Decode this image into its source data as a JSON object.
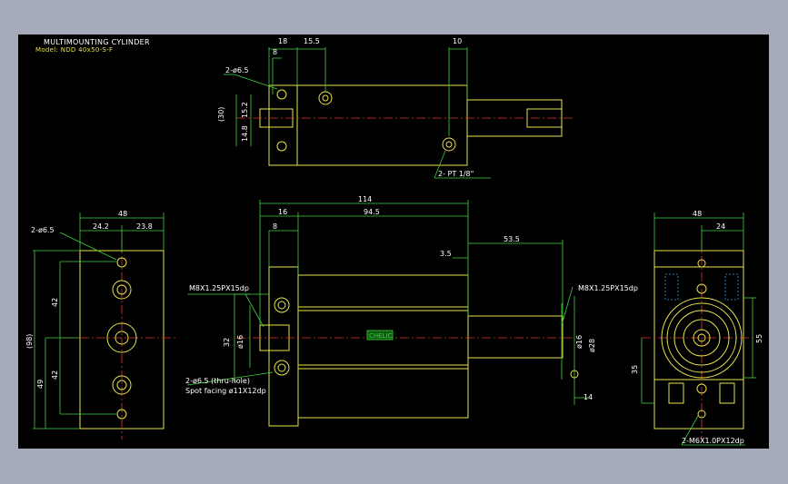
{
  "drawing": {
    "title": "MULTIMOUNTING CYLINDER",
    "model": "Model: NDD 40x50-S-F"
  },
  "top_view": {
    "dim_18": "18",
    "dim_15_5": "15.5",
    "dim_10": "10",
    "dim_8": "8",
    "hole_label": "2-ø6.5",
    "dim_30": "(30)",
    "dim_15_2": "15.2",
    "dim_14_8": "14.8",
    "port_label": "2- PT 1/8\""
  },
  "front_view": {
    "dim_114": "114",
    "dim_16": "16",
    "dim_94_5": "94.5",
    "dim_8": "8",
    "dim_53_5": "53.5",
    "dim_3_5": "3.5",
    "thread_left": "M8X1.25PX15dp",
    "thread_right": "M8X1.25PX15dp",
    "dim_32": "32",
    "dim_phi16_left": "ø16",
    "dim_phi16_right": "ø16",
    "dim_phi28": "ø28",
    "hole_label_1": "2-ø6.5 (thru-hole)",
    "hole_label_2": "Spot facing ø11X12dp",
    "dim_14": "14",
    "logo": "CHELIC"
  },
  "left_view": {
    "dim_48": "48",
    "dim_24_2": "24.2",
    "dim_23_8": "23.8",
    "hole_label": "2-ø6.5",
    "dim_42a": "42",
    "dim_42b": "42",
    "dim_98": "(98)",
    "dim_49": "49"
  },
  "right_view": {
    "dim_48": "48",
    "dim_24": "24",
    "dim_55": "55",
    "dim_35": "35",
    "thread_label": "2-M6X1.0PX12dp"
  },
  "colors": {
    "background": "#000000",
    "outline": "#e6e34a",
    "dimension": "#3fd13f",
    "centerline": "#e2362a",
    "hidden": "#2aa0e6",
    "white": "#ffffff"
  }
}
